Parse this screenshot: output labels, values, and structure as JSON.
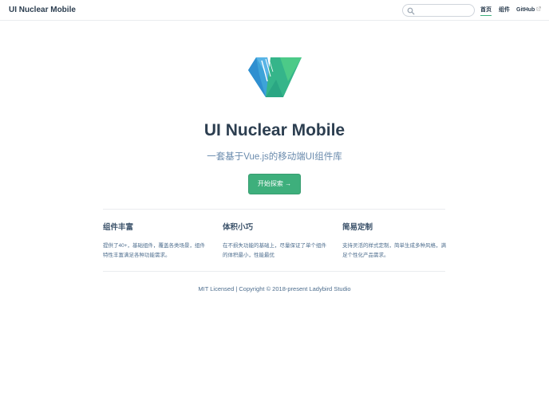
{
  "navbar": {
    "site_title": "UI Nuclear Mobile",
    "search": {
      "placeholder": "",
      "value": ""
    },
    "links": [
      {
        "label": "首页",
        "active": true
      },
      {
        "label": "组件",
        "active": false
      },
      {
        "label": "GitHub",
        "active": false,
        "external": true
      }
    ]
  },
  "hero": {
    "logo": "v-logo",
    "title": "UI Nuclear Mobile",
    "description": "一套基于Vue.js的移动端UI组件库",
    "action_label": "开始探索 →"
  },
  "features": [
    {
      "title": "组件丰富",
      "details": "提供了40+，基础组件，覆盖各类场景，组件特性丰富满足各种功能需求。"
    },
    {
      "title": "体积小巧",
      "details": "在不损失功能的基础上，尽量保证了单个组件的体积最小，性能最优"
    },
    {
      "title": "简易定制",
      "details": "支持灵活的样式定制，简单生成多种风格，满足个性化产品需求。"
    }
  ],
  "footer": {
    "text": "MIT Licensed | Copyright © 2018-present Ladybird Studio"
  },
  "colors": {
    "accent": "#3eaf7c",
    "text": "#2c3e50",
    "muted": "#6a8bad",
    "border": "#eaecef"
  }
}
